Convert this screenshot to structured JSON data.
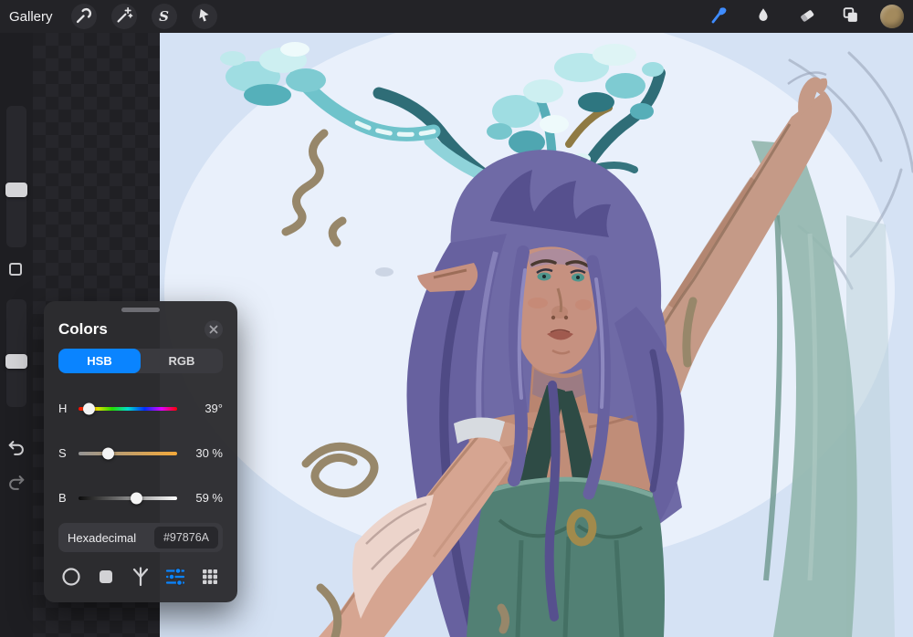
{
  "topbar": {
    "gallery_label": "Gallery",
    "left_tools": [
      {
        "id": "actions",
        "icon": "wrench-icon"
      },
      {
        "id": "adjustments",
        "icon": "magic-wand-icon"
      },
      {
        "id": "selection",
        "icon": "selection-s-icon",
        "glyph": "S"
      },
      {
        "id": "transform",
        "icon": "transform-arrow-icon"
      }
    ],
    "right_tools": [
      {
        "id": "paint",
        "icon": "brush-icon",
        "active": true
      },
      {
        "id": "smudge",
        "icon": "smudge-icon",
        "active": false
      },
      {
        "id": "erase",
        "icon": "eraser-icon",
        "active": false
      },
      {
        "id": "layers",
        "icon": "layers-icon",
        "active": false
      }
    ],
    "current_color": "#a38a5d"
  },
  "sidebar": {
    "controls": [
      "brush-size-slider",
      "modify-button",
      "opacity-slider",
      "undo-button",
      "redo-button"
    ]
  },
  "colors_panel": {
    "title": "Colors",
    "tabs": [
      {
        "label": "HSB",
        "active": true
      },
      {
        "label": "RGB",
        "active": false
      }
    ],
    "sliders": [
      {
        "label": "H",
        "value": "39°",
        "knob_percent": 11
      },
      {
        "label": "S",
        "value": "30 %",
        "knob_percent": 30
      },
      {
        "label": "B",
        "value": "59 %",
        "knob_percent": 59
      }
    ],
    "hex_label": "Hexadecimal",
    "hex_value": "#97876A",
    "modes": [
      "disc",
      "classic",
      "harmony",
      "value",
      "palettes"
    ],
    "active_mode": "value",
    "accent": "#0a84ff"
  },
  "canvas": {
    "artwork_alt": "Digital painting of a woman with long purple hair and branch antlers with teal foliage, green bodice, raised right arm, on a pale blue oval background"
  }
}
